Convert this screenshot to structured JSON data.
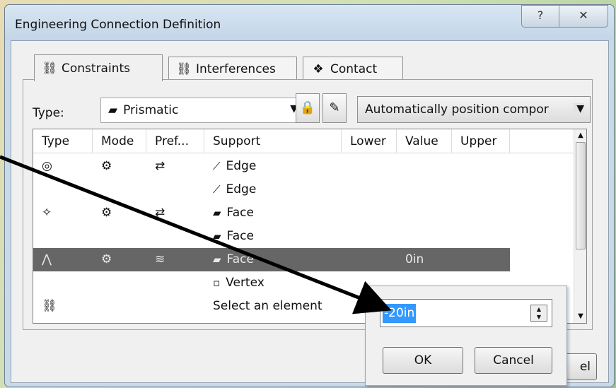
{
  "window": {
    "title": "Engineering Connection Definition",
    "help_glyph": "?",
    "close_glyph": "✕"
  },
  "tabs": [
    {
      "label": "Constraints",
      "icon": "⛓"
    },
    {
      "label": "Interferences",
      "icon": "⛓"
    },
    {
      "label": "Contact",
      "icon": "❖"
    }
  ],
  "type_row": {
    "label": "Type:",
    "combo_value": "Prismatic",
    "combo_icon": "▰",
    "lock_icon": "🔒",
    "wand_icon": "✎",
    "auto_position": "Automatically position compor",
    "arrow": "▼"
  },
  "table": {
    "headers": [
      "Type",
      "Mode",
      "Pref...",
      "Support",
      "Lower",
      "Value",
      "Upper"
    ],
    "rows": [
      {
        "type": "◎",
        "mode": "⚙",
        "pref": "⇄",
        "support": "Edge",
        "support_icon": "⟋",
        "lower": "",
        "value": "",
        "upper": ""
      },
      {
        "type": "",
        "mode": "",
        "pref": "",
        "support": "Edge",
        "support_icon": "⟋",
        "lower": "",
        "value": "",
        "upper": ""
      },
      {
        "type": "✧",
        "mode": "⚙",
        "pref": "⇄",
        "support": "Face",
        "support_icon": "▰",
        "lower": "",
        "value": "",
        "upper": ""
      },
      {
        "type": "",
        "mode": "",
        "pref": "",
        "support": "Face",
        "support_icon": "▰",
        "lower": "",
        "value": "",
        "upper": ""
      },
      {
        "type": "⋀",
        "mode": "⚙",
        "pref": "≋",
        "support": "Face",
        "support_icon": "▰",
        "lower": "",
        "value": "0in",
        "upper": ""
      },
      {
        "type": "",
        "mode": "",
        "pref": "",
        "support": "Vertex",
        "support_icon": "▫",
        "lower": "",
        "value": "",
        "upper": ""
      },
      {
        "type": "⛓",
        "mode": "",
        "pref": "",
        "support": "Select an element",
        "support_icon": "",
        "lower": "",
        "value": "",
        "upper": ""
      }
    ]
  },
  "popup": {
    "value": "-20in",
    "ok": "OK",
    "cancel": "Cancel"
  },
  "bottom_cancel_partial": "el",
  "colors": {
    "selected_row": "#666666",
    "highlight": "#3399ff",
    "titlebar": "#c9d9e8"
  }
}
